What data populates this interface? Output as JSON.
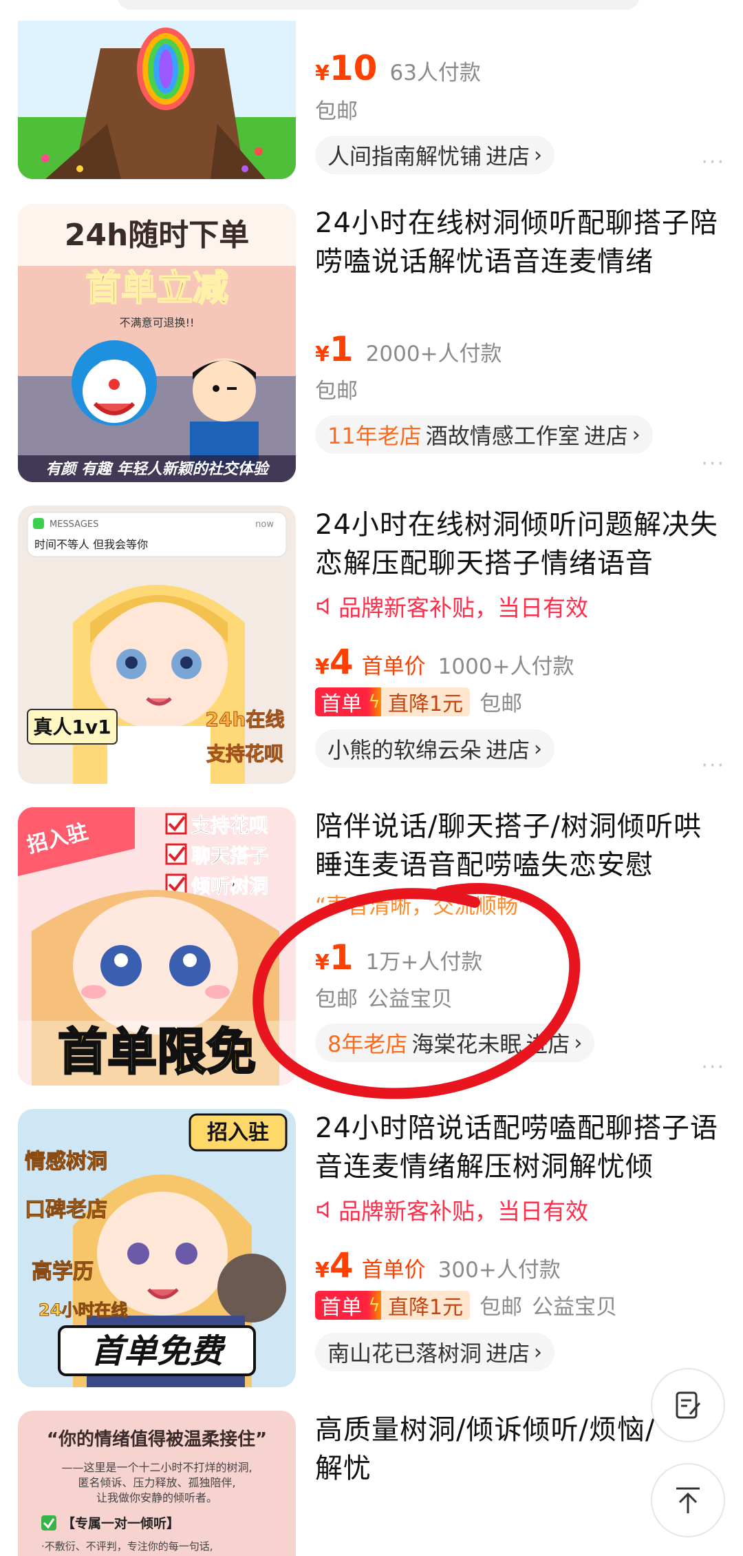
{
  "products": [
    {
      "price_yen": "¥",
      "price": "10",
      "paid_count": "63人付款",
      "tags": [
        "包邮"
      ],
      "shop_name": "人间指南解忧铺",
      "enter_label": "进店"
    },
    {
      "title": "24小时在线树洞倾听配聊搭子陪唠嗑说话解忧语音连麦情绪",
      "price_yen": "¥",
      "price": "1",
      "paid_count": "2000+人付款",
      "tags": [
        "包邮"
      ],
      "shop_badge": "11年老店",
      "shop_name": "酒故情感工作室",
      "enter_label": "进店",
      "image_text_top": "24h随时下单",
      "image_text_promo": "首单立减",
      "image_text_sub": "不满意可退换!!",
      "image_text_bottom": "有颜 有趣 年轻人新颖的社交体验"
    },
    {
      "title": "24小时在线树洞倾听问题解决失恋解压配聊天搭子情绪语音",
      "promo_text": "品牌新客补贴，当日有效",
      "price_yen": "¥",
      "price": "4",
      "price_tag": "首单价",
      "paid_count": "1000+人付款",
      "badge_left": "首单",
      "badge_right": "直降1元",
      "tags": [
        "包邮"
      ],
      "shop_name": "小熊的软绵云朵",
      "enter_label": "进店",
      "image_msg_app": "MESSAGES",
      "image_msg_time": "now",
      "image_msg_text": "时间不等人 但我会等你",
      "image_text_a": "真人1v1",
      "image_text_b": "24h在线",
      "image_text_c": "支持花呗"
    },
    {
      "title": "陪伴说话/聊天搭子/树洞倾听哄睡连麦语音配唠嗑失恋安慰",
      "quote": "“声音清晰，交流顺畅”",
      "price_yen": "¥",
      "price": "1",
      "paid_count": "1万+人付款",
      "tags": [
        "包邮",
        "公益宝贝"
      ],
      "shop_badge": "8年老店",
      "shop_name": "海棠花未眠",
      "enter_label": "进店",
      "image_ribbon": "招入驻",
      "image_checks": [
        "支持花呗",
        "聊天搭子",
        "倾听树洞"
      ],
      "image_text_bottom": "首单限免"
    },
    {
      "title": "24小时陪说话配唠嗑配聊搭子语音连麦情绪解压树洞解忧倾",
      "promo_text": "品牌新客补贴，当日有效",
      "price_yen": "¥",
      "price": "4",
      "price_tag": "首单价",
      "paid_count": "300+人付款",
      "badge_left": "首单",
      "badge_right": "直降1元",
      "tags": [
        "包邮",
        "公益宝贝"
      ],
      "shop_name": "南山花已落树洞",
      "enter_label": "进店",
      "image_ribbon": "招入驻",
      "image_side": [
        "情感树洞",
        "口碑老店",
        "高学历",
        "24小时在线"
      ],
      "image_text_bottom": "首单免费"
    },
    {
      "title": "高质量树洞/倾诉倾听/烦恼/解忧",
      "image_quote": "“你的情绪值得被温柔接住”",
      "image_lines": [
        "——这里是一个十二小时不打烊的树洞,",
        "匿名倾诉、压力释放、孤独陪伴,",
        "让我做你安静的倾听者。"
      ],
      "image_check": "【专属一对一倾听】",
      "image_footer": "·不敷衍、不评判，专注你的每一句话,"
    }
  ],
  "more_icon": "···",
  "fab": {
    "feedback_icon": "edit-note-icon",
    "top_icon": "arrow-up-icon"
  },
  "colors": {
    "price": "#ff4000",
    "promo": "#ff2d4a",
    "old_shop": "#ff6a1a",
    "annotation": "#e8141e"
  }
}
